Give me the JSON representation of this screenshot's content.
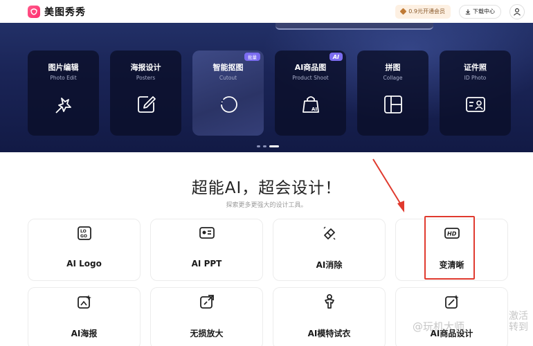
{
  "header": {
    "app_name": "美图秀秀",
    "vip_label": "0.9元开通会员",
    "download_label": "下载中心"
  },
  "hero": {
    "cards": [
      {
        "title": "图片编辑",
        "subtitle": "Photo Edit",
        "icon": "pin-magic-icon",
        "badge": ""
      },
      {
        "title": "海报设计",
        "subtitle": "Posters",
        "icon": "pen-square-icon",
        "badge": ""
      },
      {
        "title": "智能抠图",
        "subtitle": "Cutout",
        "icon": "lasso-circle-icon",
        "badge": "批量"
      },
      {
        "title": "AI商品图",
        "subtitle": "Product Shoot",
        "icon": "ai-bag-icon",
        "badge": "AI"
      },
      {
        "title": "拼图",
        "subtitle": "Collage",
        "icon": "collage-grid-icon",
        "badge": ""
      },
      {
        "title": "证件照",
        "subtitle": "ID Photo",
        "icon": "id-card-icon",
        "badge": ""
      }
    ],
    "carousel_dots": 3,
    "active_dot": 3
  },
  "section": {
    "title": "超能AI，超会设计！",
    "subtitle": "探索更多更强大的设计工具。"
  },
  "tools": [
    {
      "label": "AI Logo",
      "icon": "logo-box-icon"
    },
    {
      "label": "AI PPT",
      "icon": "presentation-icon"
    },
    {
      "label": "AI消除",
      "icon": "eraser-icon"
    },
    {
      "label": "变清晰",
      "icon": "hd-icon"
    },
    {
      "label": "AI海报",
      "icon": "sparkle-image-icon"
    },
    {
      "label": "无损放大",
      "icon": "expand-image-icon"
    },
    {
      "label": "AI模特试衣",
      "icon": "model-outfit-icon"
    },
    {
      "label": "AI商品设计",
      "icon": "magic-wand-image-icon"
    }
  ],
  "annotation": {
    "highlight_color": "#e03a2e"
  },
  "watermark": {
    "text": "@玩机大师",
    "side_text": "激活 转到"
  },
  "colors": {
    "brand": "#ff2d6f",
    "hero_bg": "#1a2456",
    "badge": "#7b6cf0"
  }
}
